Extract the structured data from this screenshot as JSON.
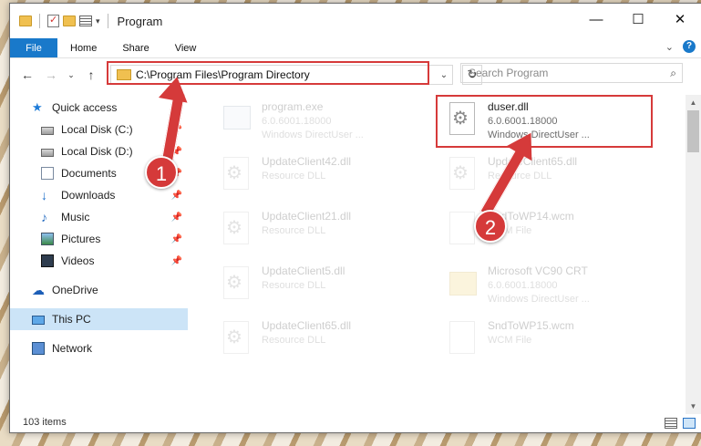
{
  "titlebar": {
    "title": "Program"
  },
  "window_controls": {
    "minimize": "—",
    "maximize": "☐",
    "close": "✕"
  },
  "ribbon": {
    "tabs": [
      "File",
      "Home",
      "Share",
      "View"
    ]
  },
  "nav": {
    "address": "C:\\Program Files\\Program Directory",
    "search_placeholder": "Search Program"
  },
  "sidebar": {
    "items": [
      {
        "label": "Quick access",
        "icon": "star-icon"
      },
      {
        "label": "Local Disk (C:)",
        "icon": "disk-icon",
        "pinned": true
      },
      {
        "label": "Local Disk (D:)",
        "icon": "disk-icon",
        "pinned": true
      },
      {
        "label": "Documents",
        "icon": "documents-icon",
        "pinned": true
      },
      {
        "label": "Downloads",
        "icon": "downloads-icon",
        "pinned": true
      },
      {
        "label": "Music",
        "icon": "music-icon",
        "pinned": true
      },
      {
        "label": "Pictures",
        "icon": "pictures-icon",
        "pinned": true
      },
      {
        "label": "Videos",
        "icon": "videos-icon",
        "pinned": true
      },
      {
        "label": "OneDrive",
        "icon": "onedrive-icon"
      },
      {
        "label": "This PC",
        "icon": "this-pc-icon",
        "selected": true
      },
      {
        "label": "Network",
        "icon": "network-icon"
      }
    ]
  },
  "files": [
    {
      "name": "program.exe",
      "line1": "6.0.6001.18000",
      "line2": "Windows DirectUser ...",
      "faded": true
    },
    {
      "name": "duser.dll",
      "line1": "6.0.6001.18000",
      "line2": "Windows DirectUser ...",
      "faded": false
    },
    {
      "name": "UpdateClient42.dll",
      "line1": "Resource DLL",
      "line2": "",
      "faded": true
    },
    {
      "name": "UpdateClient65.dll",
      "line1": "Resource DLL",
      "line2": "",
      "faded": true
    },
    {
      "name": "UpdateClient21.dll",
      "line1": "Resource DLL",
      "line2": "",
      "faded": true
    },
    {
      "name": "SndToWP14.wcm",
      "line1": "WCM File",
      "line2": "",
      "faded": true
    },
    {
      "name": "UpdateClient5.dll",
      "line1": "Resource DLL",
      "line2": "",
      "faded": true
    },
    {
      "name": "Microsoft VC90 CRT",
      "line1": "6.0.6001.18000",
      "line2": "Windows DirectUser ...",
      "faded": true
    },
    {
      "name": "UpdateClient65.dll",
      "line1": "Resource DLL",
      "line2": "",
      "faded": true
    },
    {
      "name": "SndToWP15.wcm",
      "line1": "WCM File",
      "line2": "",
      "faded": true
    }
  ],
  "status": {
    "count": "103 items"
  },
  "annotations": {
    "step1": "1",
    "step2": "2",
    "highlight_color": "#d63a3a"
  }
}
